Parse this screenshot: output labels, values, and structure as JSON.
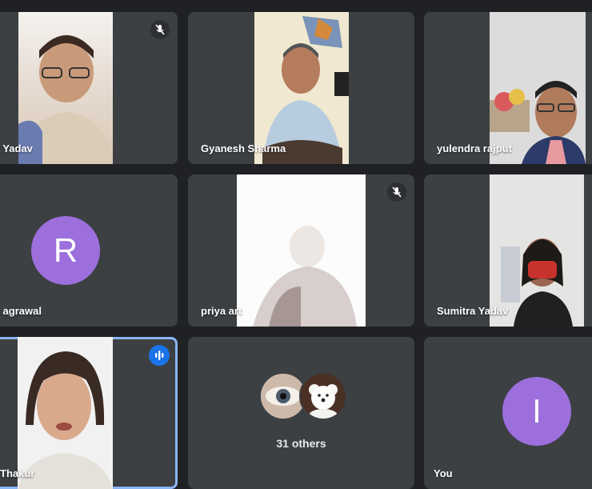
{
  "participants": [
    {
      "name": "n Yadav",
      "muted": true
    },
    {
      "name": "Gyanesh Sharma"
    },
    {
      "name": "yulendra rajput"
    },
    {
      "name": "n agrawal",
      "avatar_letter": "R",
      "avatar_color": "#9c6fdc"
    },
    {
      "name": "priya art",
      "muted": true
    },
    {
      "name": "Sumitra Yadav"
    },
    {
      "name": "Thakur",
      "speaking": true
    },
    {
      "name": "You",
      "avatar_letter": "I",
      "avatar_color": "#9c6fdc"
    }
  ],
  "others": {
    "label": "31 others"
  },
  "colors": {
    "tile_bg": "#3c4043",
    "page_bg": "#202124",
    "speaking_border": "#8ab4f8",
    "speaking_icon": "#1a73e8"
  }
}
